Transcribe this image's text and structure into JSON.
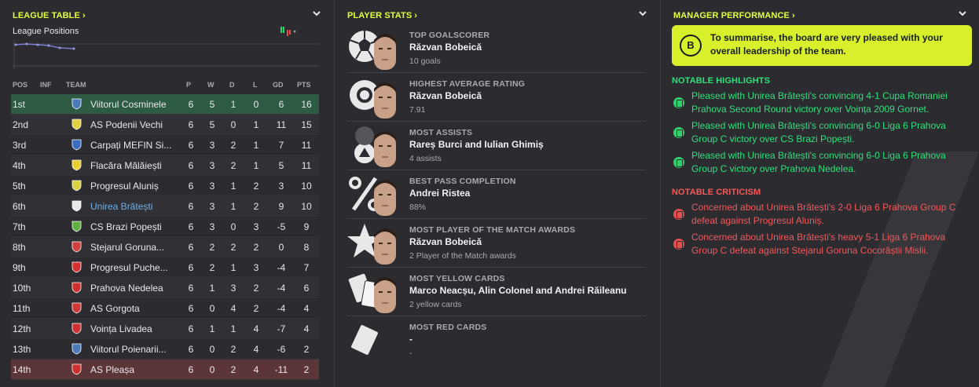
{
  "league": {
    "title": "LEAGUE TABLE",
    "positions_label": "League Positions",
    "headers": {
      "pos": "POS",
      "inf": "INF",
      "team": "TEAM",
      "p": "P",
      "w": "W",
      "d": "D",
      "l": "L",
      "gd": "GD",
      "pts": "PTS"
    },
    "rows": [
      {
        "pos": "1st",
        "team": "Viitorul Cosminele",
        "p": "6",
        "w": "5",
        "d": "1",
        "l": "0",
        "gd": "6",
        "pts": "16",
        "badge": "#4a7ab8"
      },
      {
        "pos": "2nd",
        "team": "AS Podenii Vechi",
        "p": "6",
        "w": "5",
        "d": "0",
        "l": "1",
        "gd": "11",
        "pts": "15",
        "badge": "#e0d040"
      },
      {
        "pos": "3rd",
        "team": "Carpați MEFIN Si...",
        "p": "6",
        "w": "3",
        "d": "2",
        "l": "1",
        "gd": "7",
        "pts": "11",
        "badge": "#3a6cc0"
      },
      {
        "pos": "4th",
        "team": "Flacăra Mălăiești",
        "p": "6",
        "w": "3",
        "d": "2",
        "l": "1",
        "gd": "5",
        "pts": "11",
        "badge": "#e8d030"
      },
      {
        "pos": "5th",
        "team": "Progresul Aluniș",
        "p": "6",
        "w": "3",
        "d": "1",
        "l": "2",
        "gd": "3",
        "pts": "10",
        "badge": "#d8d040"
      },
      {
        "pos": "6th",
        "team": "Unirea Brătești",
        "p": "6",
        "w": "3",
        "d": "1",
        "l": "2",
        "gd": "9",
        "pts": "10",
        "badge": "#e8e8e8"
      },
      {
        "pos": "7th",
        "team": "CS Brazi Popești",
        "p": "6",
        "w": "3",
        "d": "0",
        "l": "3",
        "gd": "-5",
        "pts": "9",
        "badge": "#60b040"
      },
      {
        "pos": "8th",
        "team": "Stejarul Goruna...",
        "p": "6",
        "w": "2",
        "d": "2",
        "l": "2",
        "gd": "0",
        "pts": "8",
        "badge": "#d04040"
      },
      {
        "pos": "9th",
        "team": "Progresul Puche...",
        "p": "6",
        "w": "2",
        "d": "1",
        "l": "3",
        "gd": "-4",
        "pts": "7",
        "badge": "#d83030"
      },
      {
        "pos": "10th",
        "team": "Prahova Nedelea",
        "p": "6",
        "w": "1",
        "d": "3",
        "l": "2",
        "gd": "-4",
        "pts": "6",
        "badge": "#d03030"
      },
      {
        "pos": "11th",
        "team": "AS Gorgota",
        "p": "6",
        "w": "0",
        "d": "4",
        "l": "2",
        "gd": "-4",
        "pts": "4",
        "badge": "#d03838"
      },
      {
        "pos": "12th",
        "team": "Voința Livadea",
        "p": "6",
        "w": "1",
        "d": "1",
        "l": "4",
        "gd": "-7",
        "pts": "4",
        "badge": "#d03030"
      },
      {
        "pos": "13th",
        "team": "Viitorul Poienarii...",
        "p": "6",
        "w": "0",
        "d": "2",
        "l": "4",
        "gd": "-6",
        "pts": "2",
        "badge": "#4a7ab8"
      },
      {
        "pos": "14th",
        "team": "AS Pleașa",
        "p": "6",
        "w": "0",
        "d": "2",
        "l": "4",
        "gd": "-11",
        "pts": "2",
        "badge": "#d03030"
      }
    ]
  },
  "player_stats": {
    "title": "PLAYER STATS",
    "items": [
      {
        "category": "TOP GOALSCORER",
        "name": "Răzvan Bobeică",
        "sub": "10 goals",
        "icon": "football-icon"
      },
      {
        "category": "HIGHEST AVERAGE RATING",
        "name": "Răzvan Bobeică",
        "sub": "7.91",
        "icon": "rating-badge-icon"
      },
      {
        "category": "MOST ASSISTS",
        "name": "Rareș Burci and Iulian Ghimiș",
        "sub": "4 assists",
        "icon": "assist-icon"
      },
      {
        "category": "BEST PASS COMPLETION",
        "name": "Andrei Ristea",
        "sub": "88%",
        "icon": "percent-icon"
      },
      {
        "category": "MOST PLAYER OF THE MATCH AWARDS",
        "name": "Răzvan Bobeică",
        "sub": "2 Player of the Match awards",
        "icon": "star-icon"
      },
      {
        "category": "MOST YELLOW CARDS",
        "name": "Marco Neacșu, Alin Colonel and Andrei Răileanu",
        "sub": "2 yellow cards",
        "icon": "cards-icon"
      },
      {
        "category": "MOST RED CARDS",
        "name": "-",
        "sub": "-",
        "icon": "card-icon"
      }
    ]
  },
  "manager": {
    "title": "MANAGER PERFORMANCE",
    "grade": "B",
    "summary": "To summarise, the board are very pleased with your overall leadership of the team.",
    "highlights_title": "NOTABLE HIGHLIGHTS",
    "highlights": [
      "Pleased with Unirea Brătești's convincing 4-1 Cupa Romaniei Prahova Second Round victory over Voința 2009 Gornet.",
      "Pleased with Unirea Brătești's convincing 6-0 Liga 6 Prahova Group C victory over CS Brazi Popești.",
      "Pleased with Unirea Brătești's convincing 6-0 Liga 6 Prahova Group C victory over Prahova Nedelea."
    ],
    "criticism_title": "NOTABLE CRITICISM",
    "criticism": [
      "Concerned about Unirea Brătești's 2-0 Liga 6 Prahova Group C defeat against Progresul Aluniș.",
      "Concerned about Unirea Brătești's heavy 5-1 Liga 6 Prahova Group C defeat against Stejarul Goruna Cocorăștii Mislii."
    ]
  },
  "colors": {
    "accent": "#e6ff3c",
    "good": "#2fe07a",
    "bad": "#f25a5a",
    "highlight_team": "#6fb0ea"
  }
}
